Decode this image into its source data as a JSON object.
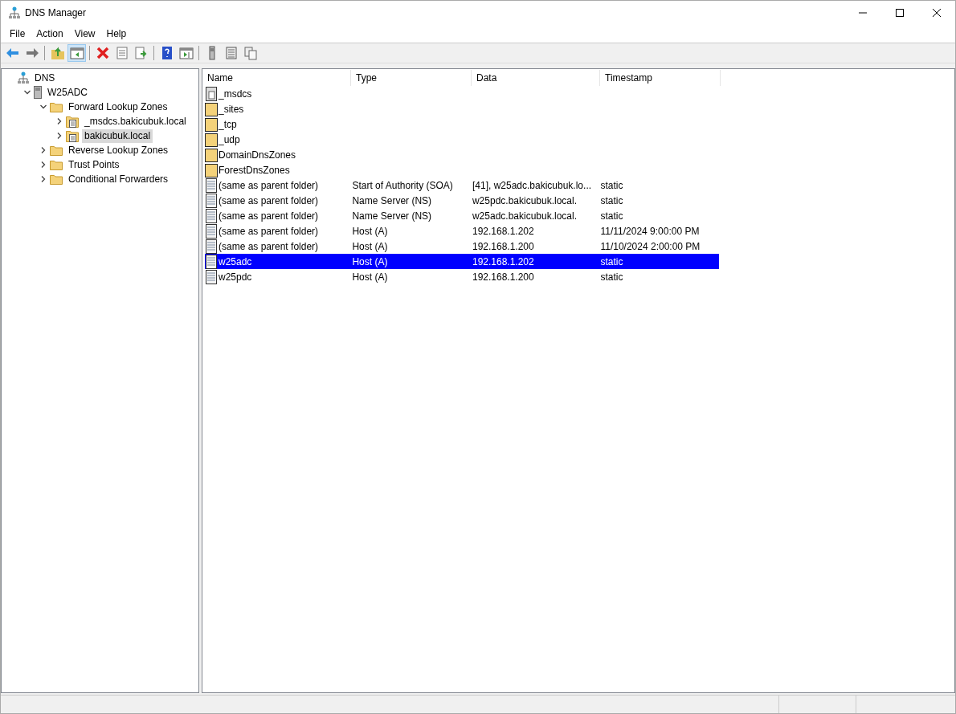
{
  "window": {
    "title": "DNS Manager"
  },
  "menu": [
    "File",
    "Action",
    "View",
    "Help"
  ],
  "toolbar": [
    {
      "kind": "back",
      "pressed": false
    },
    {
      "kind": "forward",
      "pressed": false
    },
    {
      "kind": "separator"
    },
    {
      "kind": "up",
      "pressed": false
    },
    {
      "kind": "panel",
      "pressed": true
    },
    {
      "kind": "separator"
    },
    {
      "kind": "delete",
      "pressed": false
    },
    {
      "kind": "properties",
      "pressed": false
    },
    {
      "kind": "export",
      "pressed": false
    },
    {
      "kind": "separator"
    },
    {
      "kind": "help",
      "pressed": false
    },
    {
      "kind": "action-pane",
      "pressed": false
    },
    {
      "kind": "separator"
    },
    {
      "kind": "server",
      "pressed": false
    },
    {
      "kind": "list",
      "pressed": false
    },
    {
      "kind": "copy",
      "pressed": false
    }
  ],
  "tree": [
    {
      "label": "DNS",
      "kind": "root",
      "selected": false,
      "children": [
        {
          "label": "W25ADC",
          "kind": "server",
          "expanded": true,
          "selected": false,
          "children": [
            {
              "label": "Forward Lookup Zones",
              "kind": "folder",
              "expanded": true,
              "selected": false,
              "children": [
                {
                  "label": "_msdcs.bakicubuk.local",
                  "kind": "zone",
                  "expanded": false,
                  "selected": false
                },
                {
                  "label": "bakicubuk.local",
                  "kind": "zone",
                  "expanded": false,
                  "selected": true
                }
              ]
            },
            {
              "label": "Reverse Lookup Zones",
              "kind": "folder",
              "expanded": false,
              "selected": false
            },
            {
              "label": "Trust Points",
              "kind": "folder",
              "expanded": false,
              "selected": false
            },
            {
              "label": "Conditional Forwarders",
              "kind": "folder",
              "expanded": false,
              "selected": false
            }
          ]
        }
      ]
    }
  ],
  "table": {
    "columns": [
      "Name",
      "Type",
      "Data",
      "Timestamp"
    ],
    "rows": [
      {
        "kind": "zone",
        "selected": false,
        "cells": [
          "_msdcs"
        ]
      },
      {
        "kind": "folder",
        "selected": false,
        "cells": [
          "_sites"
        ]
      },
      {
        "kind": "folder",
        "selected": false,
        "cells": [
          "_tcp"
        ]
      },
      {
        "kind": "folder",
        "selected": false,
        "cells": [
          "_udp"
        ]
      },
      {
        "kind": "folder",
        "selected": false,
        "cells": [
          "DomainDnsZones"
        ]
      },
      {
        "kind": "folder",
        "selected": false,
        "cells": [
          "ForestDnsZones"
        ]
      },
      {
        "kind": "record",
        "selected": false,
        "cells": [
          "(same as parent folder)",
          "Start of Authority (SOA)",
          "[41], w25adc.bakicubuk.lo...",
          "static"
        ]
      },
      {
        "kind": "record",
        "selected": false,
        "cells": [
          "(same as parent folder)",
          "Name Server (NS)",
          "w25pdc.bakicubuk.local.",
          "static"
        ]
      },
      {
        "kind": "record",
        "selected": false,
        "cells": [
          "(same as parent folder)",
          "Name Server (NS)",
          "w25adc.bakicubuk.local.",
          "static"
        ]
      },
      {
        "kind": "record",
        "selected": false,
        "cells": [
          "(same as parent folder)",
          "Host (A)",
          "192.168.1.202",
          "11/11/2024 9:00:00 PM"
        ]
      },
      {
        "kind": "record",
        "selected": false,
        "cells": [
          "(same as parent folder)",
          "Host (A)",
          "192.168.1.200",
          "11/10/2024 2:00:00 PM"
        ]
      },
      {
        "kind": "record",
        "selected": true,
        "cells": [
          "w25adc",
          "Host (A)",
          "192.168.1.202",
          "static"
        ]
      },
      {
        "kind": "record",
        "selected": false,
        "cells": [
          "w25pdc",
          "Host (A)",
          "192.168.1.200",
          "static"
        ]
      }
    ]
  }
}
